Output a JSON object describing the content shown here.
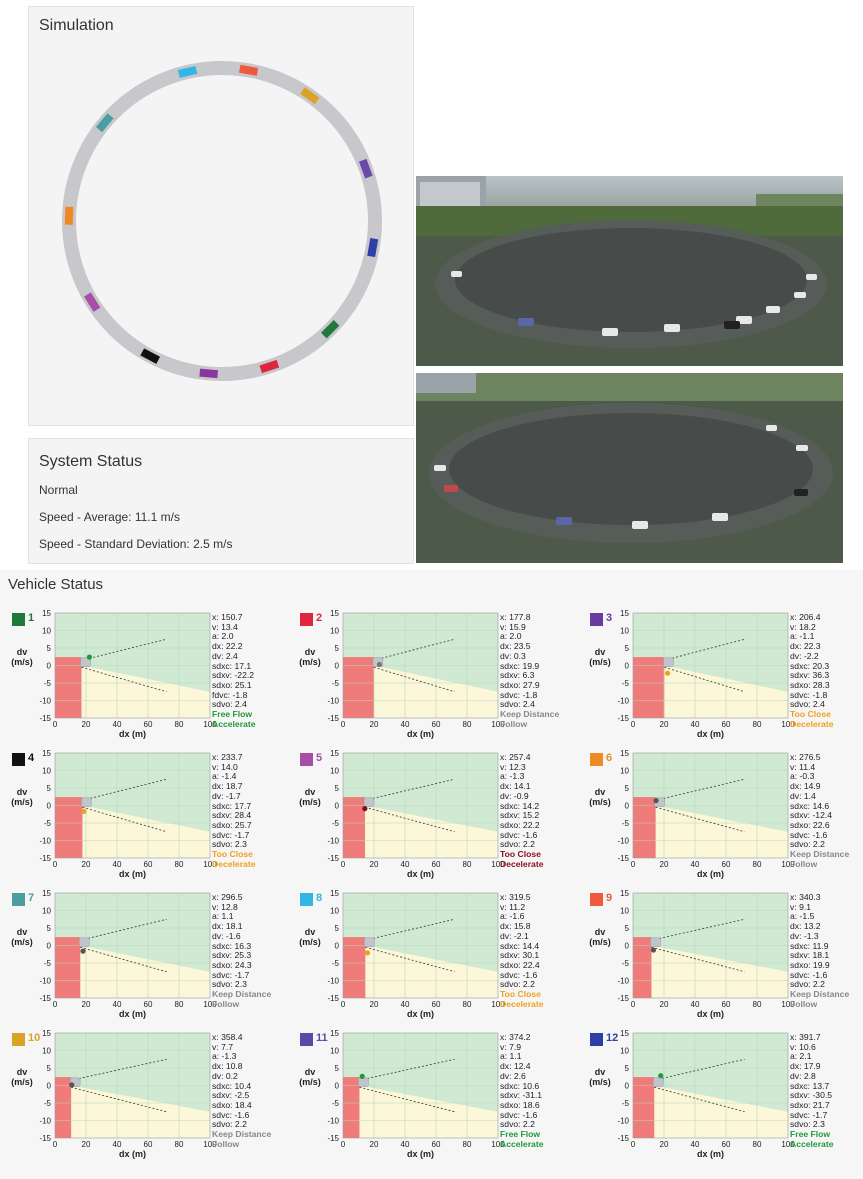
{
  "simulation": {
    "title": "Simulation",
    "ring_vehicles": [
      {
        "angle": 80,
        "color": "#ef5a3c"
      },
      {
        "angle": 55,
        "color": "#d9a325"
      },
      {
        "angle": 20,
        "color": "#6a4aa8"
      },
      {
        "angle": -10,
        "color": "#2e3fa6"
      },
      {
        "angle": -45,
        "color": "#1f7a3a"
      },
      {
        "angle": -72,
        "color": "#e0263c"
      },
      {
        "angle": -95,
        "color": "#8a36a0"
      },
      {
        "angle": -118,
        "color": "#111111"
      },
      {
        "angle": -148,
        "color": "#a84ea8"
      },
      {
        "angle": 178,
        "color": "#ee8a26"
      },
      {
        "angle": 140,
        "color": "#4a9ea0"
      },
      {
        "angle": 103,
        "color": "#32b6e6"
      }
    ]
  },
  "system_status": {
    "title": "System Status",
    "state": "Normal",
    "speed_average": "Speed - Average: 11.1 m/s",
    "speed_std": "Speed - Standard Deviation: 2.5 m/s"
  },
  "vehicle_status": {
    "title": "Vehicle Status",
    "y_axis_label_1": "dv",
    "y_axis_label_2": "(m/s)",
    "x_axis_label": "dx (m)",
    "y_ticks": [
      "15",
      "10",
      "5",
      "0",
      "-5",
      "-10",
      "-15"
    ],
    "x_ticks": [
      "0",
      "20",
      "40",
      "60",
      "80",
      "100"
    ],
    "vehicles": [
      {
        "id": "1",
        "color": "#1f7a3a",
        "x": "x: 150.7",
        "v": "v: 13.4",
        "a": "a: 2.0",
        "dx": "dx: 22.2",
        "dv": "dv: 2.4",
        "sdxc": "sdxc: 17.1",
        "sdxv": "sdxv: -22.2",
        "sdxo": "sdxo: 25.1",
        "fdvc": "fdvc: -1.8",
        "sdvo": "sdvo: 2.4",
        "state1": "Free Flow",
        "state2": "Accelerate",
        "state_color": "#1f9a3a",
        "action_color": "#1f9a3a",
        "dot_dx": 22.2,
        "dot_dv": 2.4,
        "dot_color": "#1f9a3a",
        "red_dx": 17.1
      },
      {
        "id": "2",
        "color": "#e0263c",
        "x": "x: 177.8",
        "v": "v: 15.9",
        "a": "a: 2.0",
        "dx": "dx: 23.5",
        "dv": "dv: 0.3",
        "sdxc": "sdxc: 19.9",
        "sdxv": "sdxv: 6.3",
        "sdxo": "sdxo: 27.9",
        "fdvc": "sdvc: -1.8",
        "sdvo": "sdvo: 2.4",
        "state1": "Keep Distance",
        "state2": "Follow",
        "state_color": "#888888",
        "action_color": "#888888",
        "dot_dx": 23.5,
        "dot_dv": 0.3,
        "dot_color": "#777777",
        "red_dx": 19.9
      },
      {
        "id": "3",
        "color": "#6a3aa0",
        "x": "x: 206.4",
        "v": "v: 18.2",
        "a": "a: -1.1",
        "dx": "dx: 22.3",
        "dv": "dv: -2.2",
        "sdxc": "sdxc: 20.3",
        "sdxv": "sdxv: 36.3",
        "sdxo": "sdxo: 28.3",
        "fdvc": "sdvc: -1.8",
        "sdvo": "sdvo: 2.4",
        "state1": "Too Close",
        "state2": "Decelerate",
        "state_color": "#f0a020",
        "action_color": "#f0a020",
        "dot_dx": 22.3,
        "dot_dv": -2.2,
        "dot_color": "#f0a020",
        "red_dx": 20.3
      },
      {
        "id": "4",
        "color": "#111111",
        "x": "x: 233.7",
        "v": "v: 14.0",
        "a": "a: -1.4",
        "dx": "dx: 18.7",
        "dv": "dv: -1.7",
        "sdxc": "sdxc: 17.7",
        "sdxv": "sdxv: 28.4",
        "sdxo": "sdxo: 25.7",
        "fdvc": "sdvc: -1.7",
        "sdvo": "sdvo: 2.3",
        "state1": "Too Close",
        "state2": "Decelerate",
        "state_color": "#f0a020",
        "action_color": "#f0a020",
        "dot_dx": 18.7,
        "dot_dv": -1.7,
        "dot_color": "#f0a020",
        "red_dx": 17.7
      },
      {
        "id": "5",
        "color": "#a84ea8",
        "x": "x: 257.4",
        "v": "v: 12.3",
        "a": "a: -1.3",
        "dx": "dx: 14.1",
        "dv": "dv: -0.9",
        "sdxc": "sdxc: 14.2",
        "sdxv": "sdxv: 15.2",
        "sdxo": "sdxo: 22.2",
        "fdvc": "sdvc: -1.6",
        "sdvo": "sdvo: 2.2",
        "state1": "Too Close",
        "state2": "Decelerate",
        "state_color": "#8a1020",
        "action_color": "#8a1020",
        "dot_dx": 14.1,
        "dot_dv": -0.9,
        "dot_color": "#7a1020",
        "red_dx": 14.2
      },
      {
        "id": "6",
        "color": "#ee8a26",
        "x": "x: 276.5",
        "v": "v: 11.4",
        "a": "a: -0.3",
        "dx": "dx: 14.9",
        "dv": "dv: 1.4",
        "sdxc": "sdxc: 14.6",
        "sdxv": "sdxv: -12.4",
        "sdxo": "sdxo: 22.6",
        "fdvc": "sdvc: -1.6",
        "sdvo": "sdvo: 2.2",
        "state1": "Keep Distance",
        "state2": "Follow",
        "state_color": "#888888",
        "action_color": "#888888",
        "dot_dx": 14.9,
        "dot_dv": 1.4,
        "dot_color": "#555555",
        "red_dx": 14.6
      },
      {
        "id": "7",
        "color": "#4a9ea0",
        "x": "x: 296.5",
        "v": "v: 12.8",
        "a": "a: 1.1",
        "dx": "dx: 18.1",
        "dv": "dv: -1.6",
        "sdxc": "sdxc: 16.3",
        "sdxv": "sdxv: 25.3",
        "sdxo": "sdxo: 24.3",
        "fdvc": "sdvc: -1.7",
        "sdvo": "sdvo: 2.3",
        "state1": "Keep Distance",
        "state2": "Follow",
        "state_color": "#888888",
        "action_color": "#888888",
        "dot_dx": 18.1,
        "dot_dv": -1.6,
        "dot_color": "#555555",
        "red_dx": 16.3
      },
      {
        "id": "8",
        "color": "#32b6e6",
        "x": "x: 319.5",
        "v": "v: 11.2",
        "a": "a: -1.6",
        "dx": "dx: 15.8",
        "dv": "dv: -2.1",
        "sdxc": "sdxc: 14.4",
        "sdxv": "sdxv: 30.1",
        "sdxo": "sdxo: 22.4",
        "fdvc": "sdvc: -1.6",
        "sdvo": "sdvo: 2.2",
        "state1": "Too Close",
        "state2": "Decelerate",
        "state_color": "#f0a020",
        "action_color": "#f0a020",
        "dot_dx": 15.8,
        "dot_dv": -2.1,
        "dot_color": "#f0a020",
        "red_dx": 14.4
      },
      {
        "id": "9",
        "color": "#ef5a3c",
        "x": "x: 340.3",
        "v": "v: 9.1",
        "a": "a: -1.5",
        "dx": "dx: 13.2",
        "dv": "dv: -1.3",
        "sdxc": "sdxc: 11.9",
        "sdxv": "sdxv: 18.1",
        "sdxo": "sdxo: 19.9",
        "fdvc": "sdvc: -1.6",
        "sdvo": "sdvo: 2.2",
        "state1": "Keep Distance",
        "state2": "Follow",
        "state_color": "#888888",
        "action_color": "#888888",
        "dot_dx": 13.2,
        "dot_dv": -1.3,
        "dot_color": "#555555",
        "red_dx": 11.9
      },
      {
        "id": "10",
        "color": "#d9a325",
        "x": "x: 358.4",
        "v": "v: 7.7",
        "a": "a: -1.3",
        "dx": "dx: 10.8",
        "dv": "dv: 0.2",
        "sdxc": "sdxc: 10.4",
        "sdxv": "sdxv: -2.5",
        "sdxo": "sdxo: 18.4",
        "fdvc": "sdvc: -1.6",
        "sdvo": "sdvo: 2.2",
        "state1": "Keep Distance",
        "state2": "Follow",
        "state_color": "#888888",
        "action_color": "#888888",
        "dot_dx": 10.8,
        "dot_dv": 0.2,
        "dot_color": "#555555",
        "red_dx": 10.4
      },
      {
        "id": "11",
        "color": "#5a4aa8",
        "x": "x: 374.2",
        "v": "v: 7.9",
        "a": "a: 1.1",
        "dx": "dx: 12.4",
        "dv": "dv: 2.6",
        "sdxc": "sdxc: 10.6",
        "sdxv": "sdxv: -31.1",
        "sdxo": "sdxo: 18.6",
        "fdvc": "sdvc: -1.6",
        "sdvo": "sdvo: 2.2",
        "state1": "Free Flow",
        "state2": "Accelerate",
        "state_color": "#1f9a3a",
        "action_color": "#1f9a3a",
        "dot_dx": 12.4,
        "dot_dv": 2.6,
        "dot_color": "#1f9a3a",
        "red_dx": 10.6
      },
      {
        "id": "12",
        "color": "#2e3fa6",
        "x": "x: 391.7",
        "v": "v: 10.6",
        "a": "a: 2.1",
        "dx": "dx: 17.9",
        "dv": "dv: 2.8",
        "sdxc": "sdxc: 13.7",
        "sdxv": "sdxv: -30.5",
        "sdxo": "sdxo: 21.7",
        "fdvc": "sdvc: -1.7",
        "sdvo": "sdvo: 2.3",
        "state1": "Free Flow",
        "state2": "Accelerate",
        "state_color": "#1f9a3a",
        "action_color": "#1f9a3a",
        "dot_dx": 17.9,
        "dot_dv": 2.8,
        "dot_color": "#1f9a3a",
        "red_dx": 13.7
      }
    ]
  }
}
